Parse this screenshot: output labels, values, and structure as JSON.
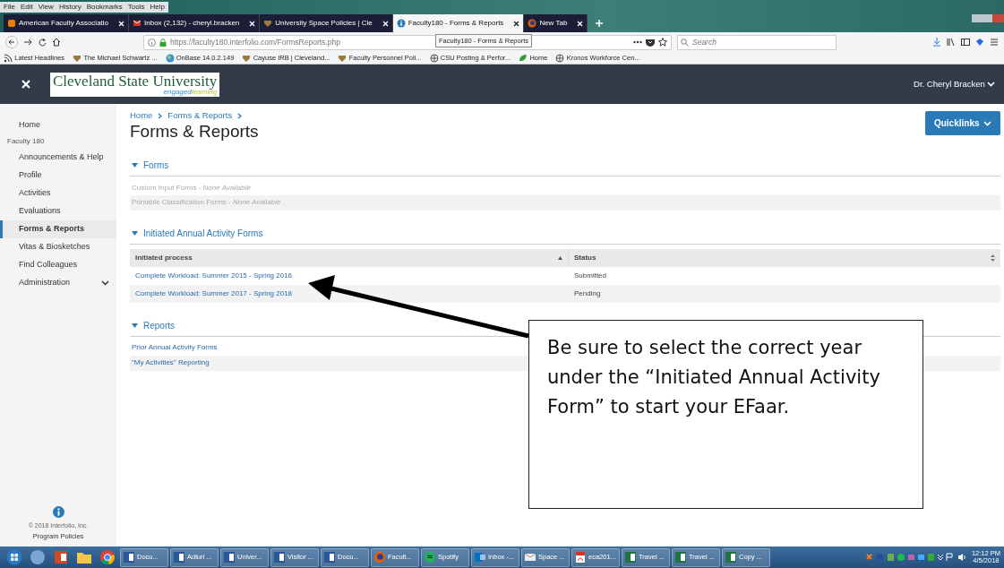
{
  "browser": {
    "menu": [
      "File",
      "Edit",
      "View",
      "History",
      "Bookmarks",
      "Tools",
      "Help"
    ],
    "tabs": [
      {
        "title": "American Faculty Associatio",
        "selected": false
      },
      {
        "title": "Inbox (2,132) - cheryl.bracken",
        "selected": false
      },
      {
        "title": "University Space Policies | Cle",
        "selected": false
      },
      {
        "title": "Faculty180 - Forms & Reports",
        "selected": true
      },
      {
        "title": "New Tab",
        "selected": false
      }
    ],
    "tooltip": "Faculty180 - Forms & Reports",
    "url": "https://faculty180.interfolio.com/FormsReports.php",
    "search": {
      "placeholder": "Search"
    },
    "bookmarks": [
      "Latest Headlines",
      "The Michael Schwartz ...",
      "OnBase 14.0.2.149",
      "Cayuse IRB | Cleveland...",
      "Faculty Personnel Poli...",
      "CSU Posting & Perfor...",
      "Home",
      "Kronos Workforce Cen..."
    ]
  },
  "app": {
    "logo": {
      "name": "Cleveland State University",
      "tagline": [
        "engaged",
        "learning"
      ]
    },
    "user": "Dr. Cheryl Bracken"
  },
  "sidebar": {
    "items": [
      {
        "label": "Home",
        "kind": "top",
        "selected": false
      },
      {
        "label": "Faculty 180",
        "kind": "heading"
      },
      {
        "label": "Announcements & Help",
        "kind": "link",
        "selected": false
      },
      {
        "label": "Profile",
        "kind": "link",
        "selected": false
      },
      {
        "label": "Activities",
        "kind": "link",
        "selected": false
      },
      {
        "label": "Evaluations",
        "kind": "link",
        "selected": false
      },
      {
        "label": "Forms & Reports",
        "kind": "link",
        "selected": true
      },
      {
        "label": "Vitas & Biosketches",
        "kind": "link",
        "selected": false
      },
      {
        "label": "Find Colleagues",
        "kind": "link",
        "selected": false
      },
      {
        "label": "Administration",
        "kind": "link",
        "selected": false,
        "expanded": false
      }
    ],
    "copyright": "© 2018 Interfolio, Inc.",
    "policies": "Program Policies"
  },
  "breadcrumbs": [
    "Home",
    "Forms & Reports"
  ],
  "title": "Forms & Reports",
  "quicklinks": "Quicklinks",
  "sections": [
    {
      "title": "Forms",
      "expanded": true,
      "kind": "list",
      "rows": [
        {
          "text": "Custom Input Forms - *None Available*",
          "disabled": true
        },
        {
          "text": "Printable Classification Forms - *None Available*",
          "disabled": true
        }
      ]
    },
    {
      "title": "Initiated Annual Activity Forms",
      "expanded": true,
      "kind": "table",
      "columns": [
        "Initiated process",
        "Status"
      ],
      "rows": [
        [
          "Complete Workload: Summer 2015 - Spring 2016",
          "Submitted"
        ],
        [
          "Complete Workload: Summer 2017 - Spring 2018",
          "Pending"
        ]
      ]
    },
    {
      "title": "Reports",
      "expanded": true,
      "kind": "list",
      "rows": [
        {
          "text": "Prior Annual Activity Forms",
          "disabled": false
        },
        {
          "text": "\"My Activities\" Reporting",
          "disabled": false
        }
      ]
    }
  ],
  "callout": "Be sure to select the correct year under the “Initiated Annual Activity Form” to start your EFaar.",
  "taskbar": {
    "items": [
      {
        "label": "Docu...",
        "kind": "word"
      },
      {
        "label": "Adluri ...",
        "kind": "word"
      },
      {
        "label": "Univer...",
        "kind": "word"
      },
      {
        "label": "Visitor ...",
        "kind": "word"
      },
      {
        "label": "Docu...",
        "kind": "word"
      },
      {
        "label": "Facult...",
        "kind": "firefox"
      },
      {
        "label": "Spotify",
        "kind": "spotify"
      },
      {
        "label": "Inbox -...",
        "kind": "outlook"
      },
      {
        "label": "Space ...",
        "kind": "mail"
      },
      {
        "label": "eca201...",
        "kind": "pdf"
      },
      {
        "label": "Travel ...",
        "kind": "excel"
      },
      {
        "label": "Travel ...",
        "kind": "excel"
      },
      {
        "label": "Copy ...",
        "kind": "excel"
      }
    ],
    "time": "12:12 PM",
    "date": "4/5/2018"
  }
}
